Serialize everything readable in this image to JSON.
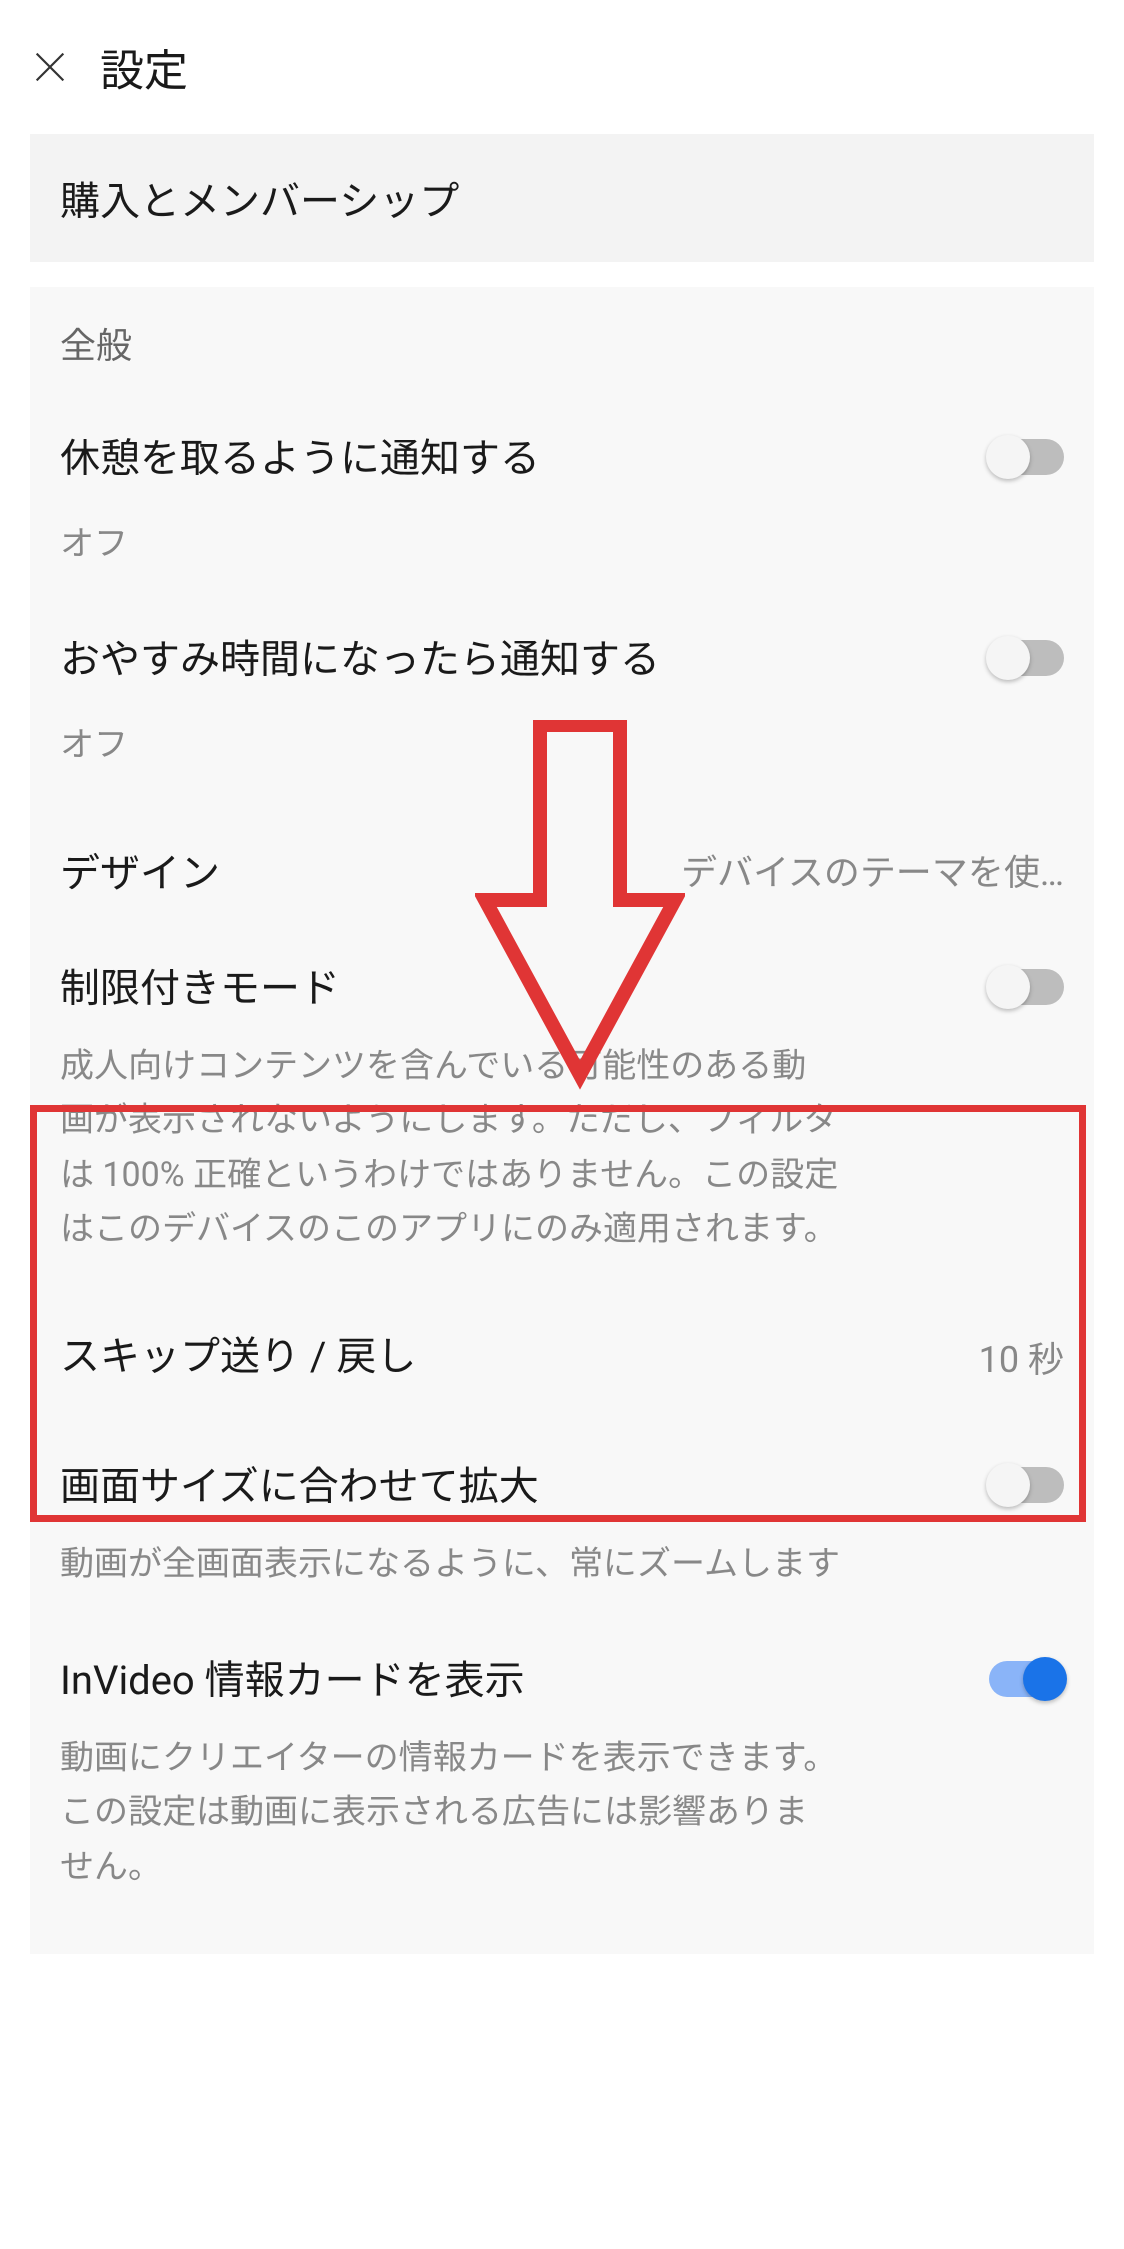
{
  "header": {
    "title": "設定"
  },
  "section1": {
    "title": "購入とメンバーシップ"
  },
  "general": {
    "label": "全般",
    "break_reminder": {
      "title": "休憩を取るように通知する",
      "status": "オフ",
      "enabled": false
    },
    "bedtime_reminder": {
      "title": "おやすみ時間になったら通知する",
      "status": "オフ",
      "enabled": false
    },
    "design": {
      "title": "デザイン",
      "value": "デバイスのテーマを使…"
    },
    "restricted_mode": {
      "title": "制限付きモード",
      "description": "成人向けコンテンツを含んでいる可能性のある動画が表示されないようにします。ただし、フィルタは 100% 正確というわけではありません。この設定はこのデバイスのこのアプリにのみ適用されます。",
      "enabled": false
    },
    "skip": {
      "title": "スキップ送り / 戻し",
      "value": "10 秒"
    },
    "zoom_fit": {
      "title": "画面サイズに合わせて拡大",
      "description": "動画が全画面表示になるように、常にズームします",
      "enabled": false
    },
    "invideo": {
      "title": "InVideo 情報カードを表示",
      "description": "動画にクリエイターの情報カードを表示できます。この設定は動画に表示される広告には影響ありません。",
      "enabled": true
    }
  }
}
